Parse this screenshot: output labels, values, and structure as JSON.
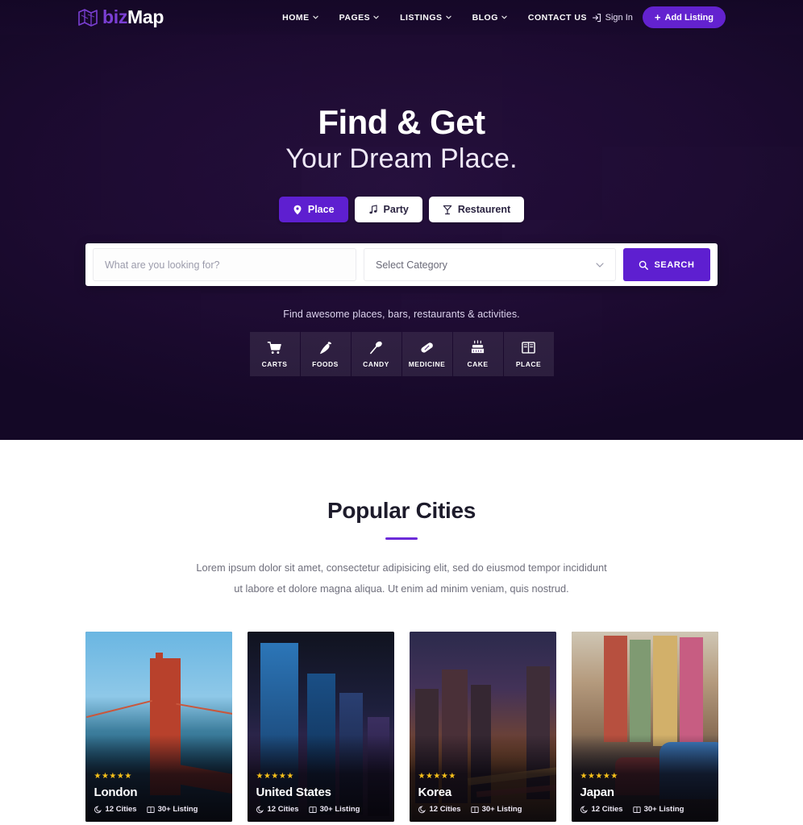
{
  "brand": {
    "name_first": "biz",
    "name_second": "Map",
    "logo_icon": "folded-map-icon",
    "accent": "#6322cf",
    "accent_alt": "#5e1fd0",
    "star_color": "#f7c11a"
  },
  "nav": {
    "links": [
      {
        "label": "HOME",
        "has_caret": true
      },
      {
        "label": "PAGES",
        "has_caret": true
      },
      {
        "label": "LISTINGS",
        "has_caret": true
      },
      {
        "label": "BLOG",
        "has_caret": true
      },
      {
        "label": "CONTACT US",
        "has_caret": false
      }
    ],
    "sign_in": "Sign In",
    "sign_in_icon": "login-icon",
    "add_listing": "Add Listing",
    "add_listing_icon": "plus-icon"
  },
  "hero": {
    "title": "Find & Get",
    "subtitle": "Your Dream Place.",
    "tabs": [
      {
        "label": "Place",
        "icon": "map-pin-icon",
        "active": true
      },
      {
        "label": "Party",
        "icon": "music-note-icon",
        "active": false
      },
      {
        "label": "Restaurent",
        "icon": "cocktail-glass-icon",
        "active": false
      }
    ],
    "search": {
      "keyword_placeholder": "What are you looking for?",
      "keyword_value": "",
      "category_selected": "Select Category",
      "category_caret_icon": "chevron-down-icon",
      "button_label": "SEARCH",
      "button_icon": "search-icon"
    },
    "tagline": "Find awesome places, bars, restaurants & activities.",
    "categories": [
      {
        "label": "CARTS",
        "icon": "shopping-cart-icon"
      },
      {
        "label": "FOODS",
        "icon": "carrot-icon"
      },
      {
        "label": "CANDY",
        "icon": "lollipop-icon"
      },
      {
        "label": "MEDICINE",
        "icon": "capsule-icon"
      },
      {
        "label": "CAKE",
        "icon": "cake-icon"
      },
      {
        "label": "PLACE",
        "icon": "open-book-icon"
      }
    ]
  },
  "cities_section": {
    "title": "Popular Cities",
    "description": "Lorem ipsum dolor sit amet, consectetur adipisicing elit, sed do eiusmod tempor incididunt ut labore et dolore magna aliqua. Ut enim ad minim veniam, quis nostrud.",
    "cards": [
      {
        "name": "London",
        "stars": "★★★★★",
        "cities": "12 Cities",
        "listings": "30+ Listing",
        "cities_icon": "moon-icon",
        "listings_icon": "book-icon"
      },
      {
        "name": "United States",
        "stars": "★★★★★",
        "cities": "12 Cities",
        "listings": "30+ Listing",
        "cities_icon": "moon-icon",
        "listings_icon": "book-icon"
      },
      {
        "name": "Korea",
        "stars": "★★★★★",
        "cities": "12 Cities",
        "listings": "30+ Listing",
        "cities_icon": "moon-icon",
        "listings_icon": "book-icon"
      },
      {
        "name": "Japan",
        "stars": "★★★★★",
        "cities": "12 Cities",
        "listings": "30+ Listing",
        "cities_icon": "moon-icon",
        "listings_icon": "book-icon"
      }
    ]
  }
}
